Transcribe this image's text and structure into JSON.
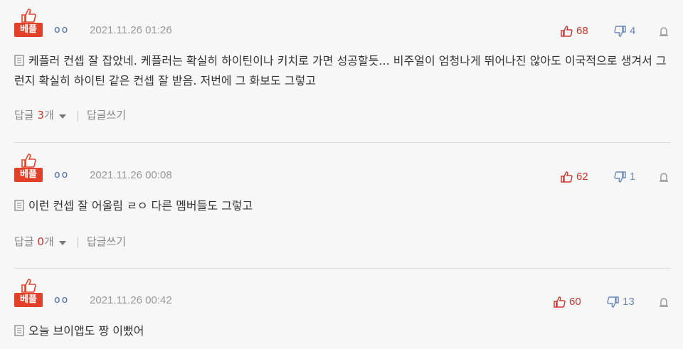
{
  "badge_label": "베플",
  "colors": {
    "accent_red": "#e3402a",
    "up_red": "#d0332b",
    "down_blue": "#6a8ab8",
    "nick_blue": "#4a6aa8"
  },
  "comments": [
    {
      "nick": "oo",
      "date": "2021.11.26 01:26",
      "up": "68",
      "down": "4",
      "text": "케플러 컨셉 잘 잡았네. 케플러는 확실히 하이틴이나 키치로 가면 성공할듯... 비주얼이 엄청나게 뛰어나진 않아도 이국적으로 생겨서 그런지 확실히 하이틴 같은 컨셉 잘 받음. 저번에 그 화보도 그렇고",
      "reply_label": "답글",
      "reply_count": "3",
      "reply_unit": "개",
      "write_label": "답글쓰기"
    },
    {
      "nick": "oo",
      "date": "2021.11.26 00:08",
      "up": "62",
      "down": "1",
      "text": "이런 컨셉 잘 어울림 ㄹㅇ 다른 멤버들도 그렇고",
      "reply_label": "답글",
      "reply_count": "0",
      "reply_unit": "개",
      "write_label": "답글쓰기"
    },
    {
      "nick": "oo",
      "date": "2021.11.26 00:42",
      "up": "60",
      "down": "13",
      "text": "오늘 브이앱도 짱 이뻤어"
    }
  ]
}
